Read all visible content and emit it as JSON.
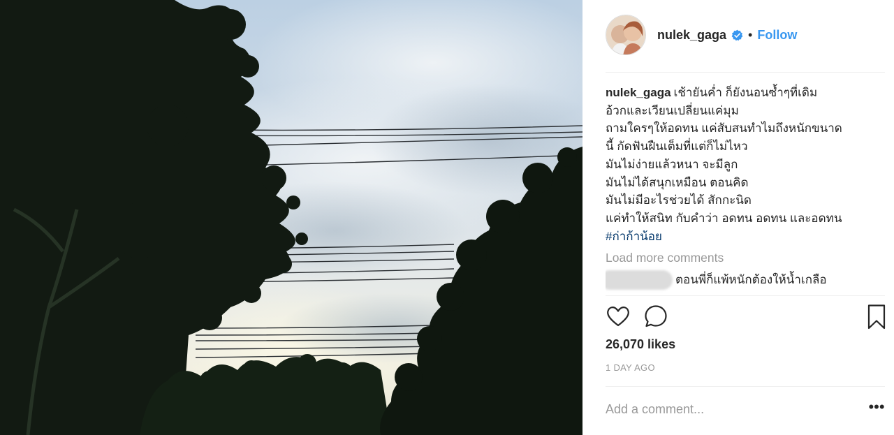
{
  "post": {
    "photo_icon": "landscape-photo",
    "author": {
      "username": "nulek_gaga",
      "verified_icon": "verified-badge-icon",
      "dot": "•",
      "follow_label": "Follow"
    },
    "caption": {
      "username": "nulek_gaga",
      "lines": [
        "เช้ายันค่ำ ก็ยังนอนซ้ำๆที่เดิม",
        "อ้วกและเวียนเปลี่ยนแค่มุม",
        "ถามใครๆให้อดทน แค่สับสนทำไมถึงหนักขนาด",
        "นี้ กัดฟันฝืนเต็มที่แต่ก็ไม่ไหว",
        "มันไม่ง่ายแล้วหนา จะมีลูก",
        "มันไม่ได้สนุกเหมือน ตอนคิด",
        "มันไม่มีอะไรช่วยได้ สักกะนิด",
        "แค่ทำให้สนิท กับคำว่า อดทน อดทน และอดทน"
      ],
      "hashtag": "#ก่าก้าน้อย"
    },
    "load_more_label": "Load more comments",
    "comment": {
      "text": "ตอนพี่ก็แพ้หนักต้องให้น้ำเกลือ"
    },
    "actions": {
      "like_icon": "heart-icon",
      "comment_icon": "comment-bubble-icon",
      "save_icon": "bookmark-icon"
    },
    "likes_text": "26,070 likes",
    "time_text": "1 DAY AGO",
    "add_comment_placeholder": "Add a comment...",
    "more_label": "•••"
  },
  "colors": {
    "link_blue": "#3897f0",
    "hashtag": "#003569",
    "muted": "#999999",
    "text": "#262626"
  }
}
